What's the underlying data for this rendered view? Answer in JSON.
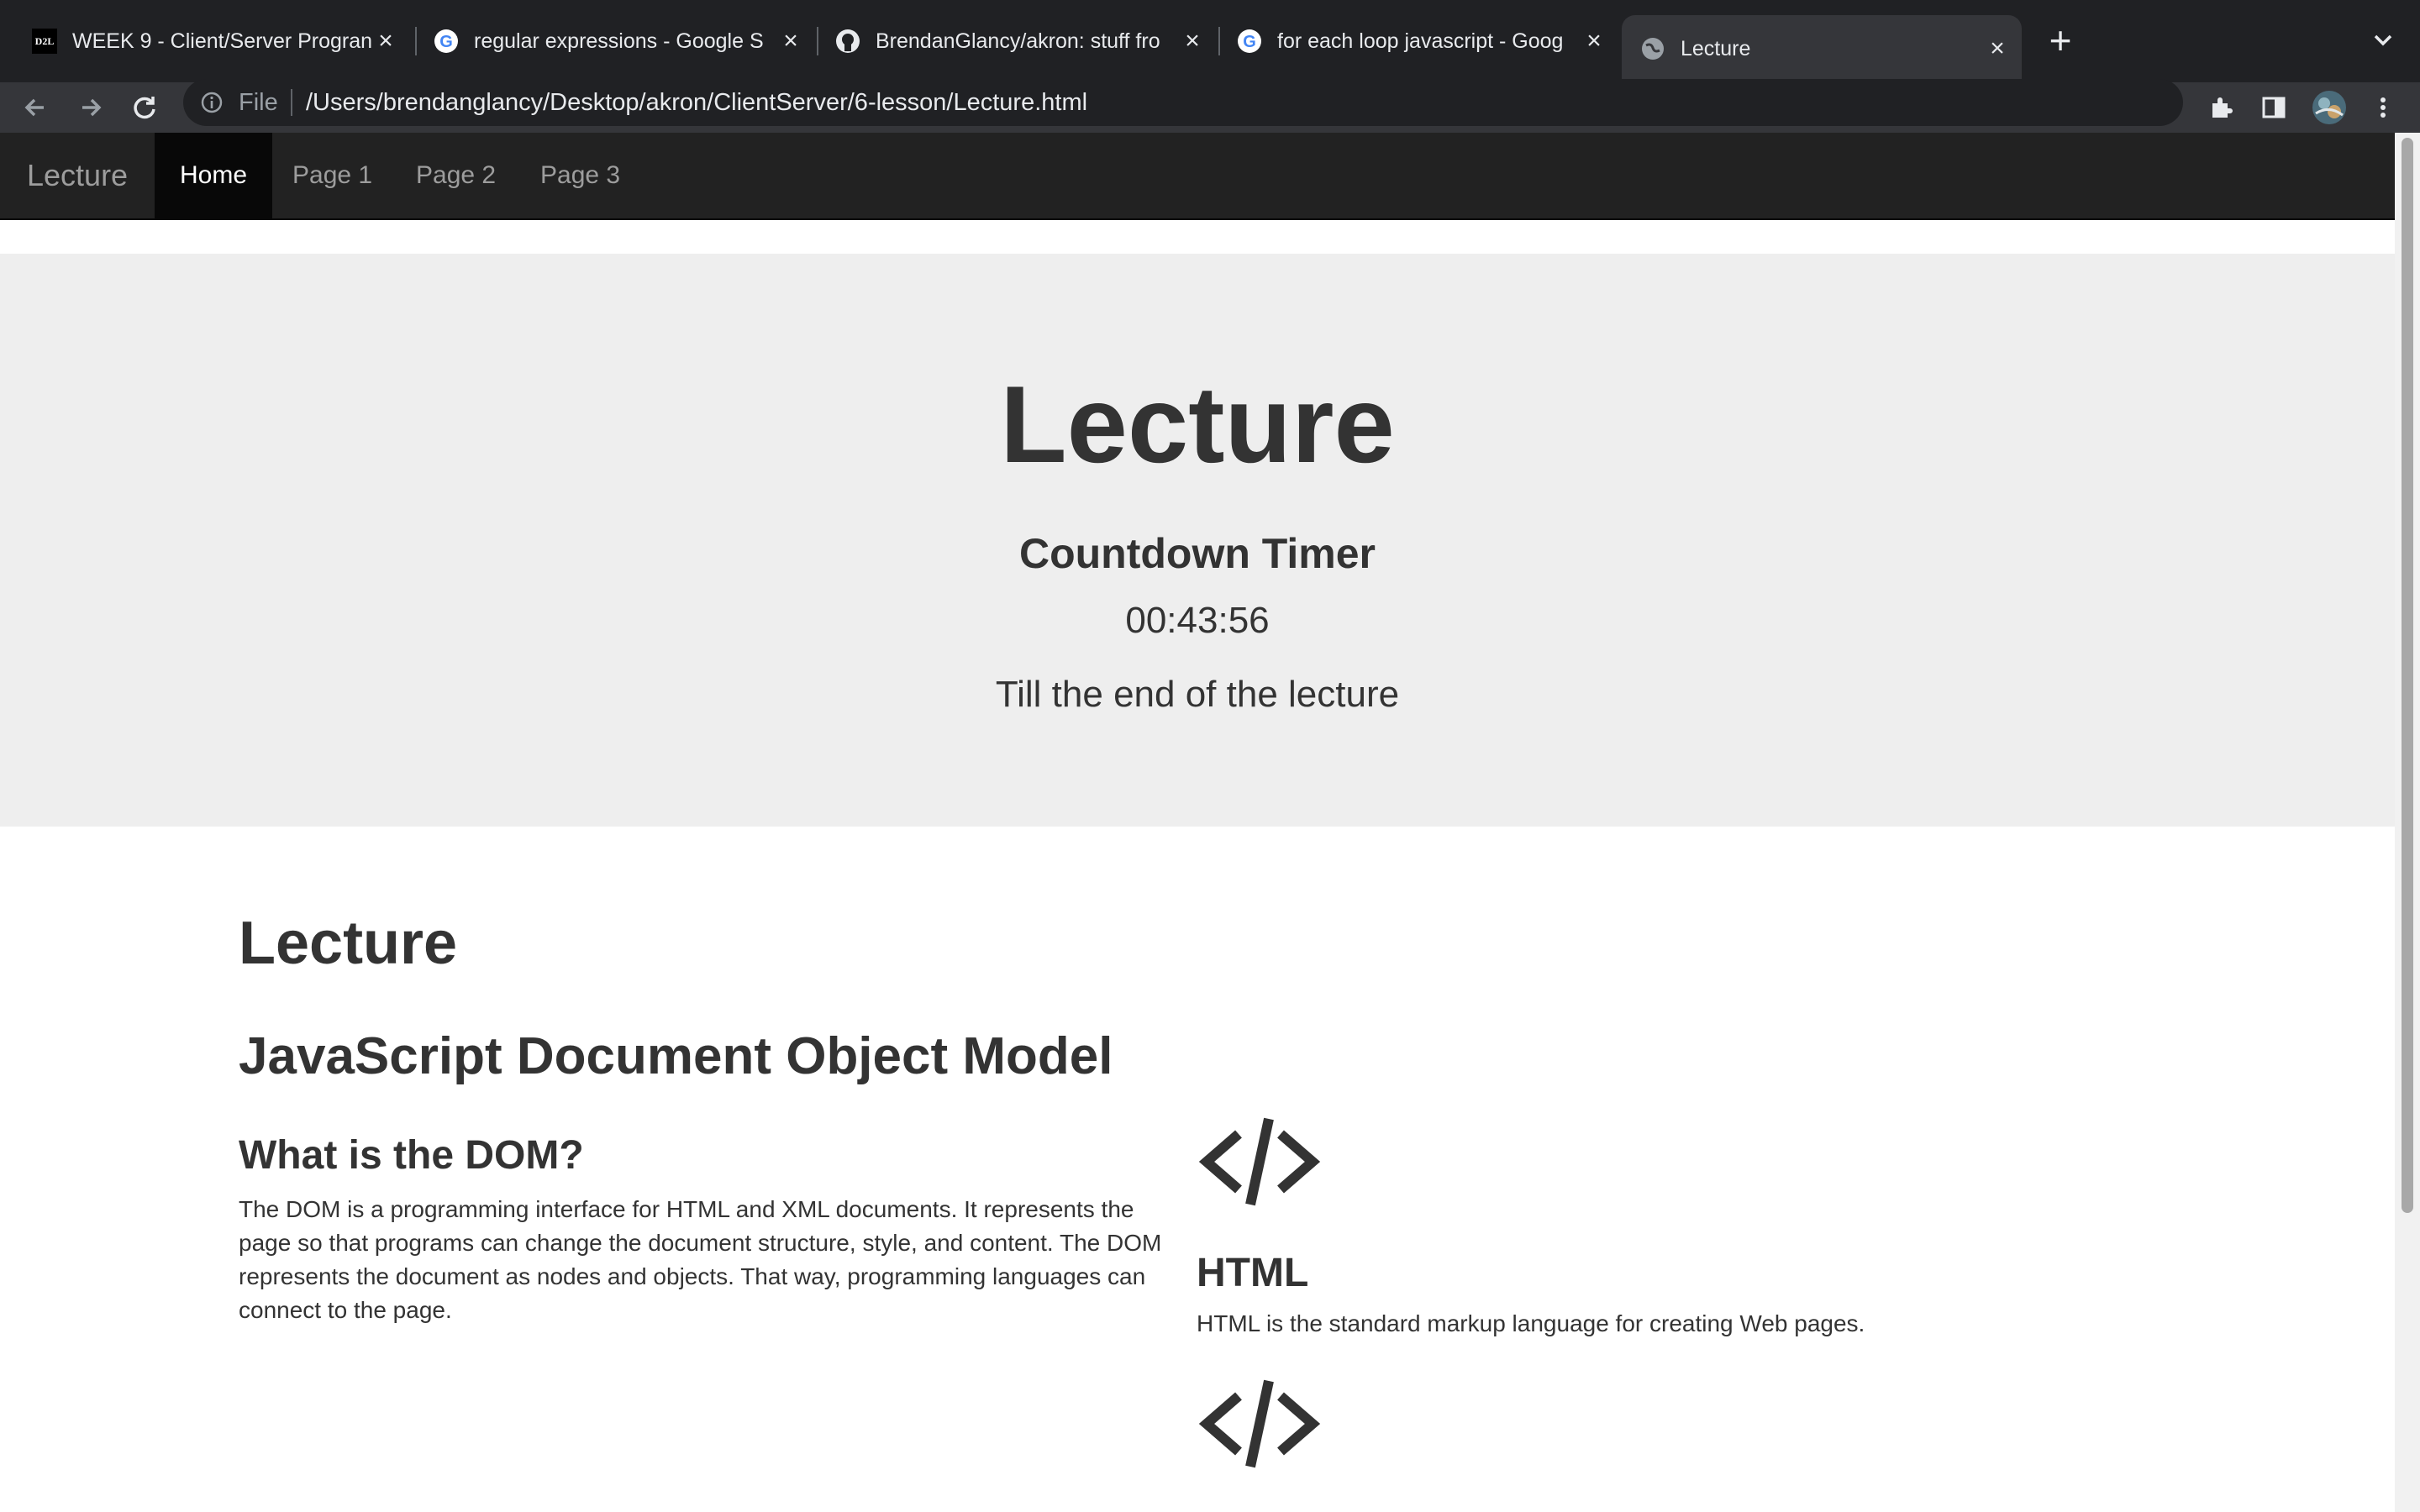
{
  "browser": {
    "tabs": [
      {
        "title": "WEEK 9 - Client/Server Progran",
        "favicon": "d2l-icon"
      },
      {
        "title": "regular expressions - Google S",
        "favicon": "google-icon"
      },
      {
        "title": "BrendanGlancy/akron: stuff fro",
        "favicon": "github-icon"
      },
      {
        "title": "for each loop javascript - Goog",
        "favicon": "google-icon"
      },
      {
        "title": "Lecture",
        "favicon": "globe-icon",
        "active": true
      }
    ],
    "url_scheme": "File",
    "url": "/Users/brendanglancy/Desktop/akron/ClientServer/6-lesson/Lecture.html",
    "d2l_favicon_text": "D2L"
  },
  "navbar": {
    "brand": "Lecture",
    "items": [
      {
        "label": "Home",
        "active": true
      },
      {
        "label": "Page 1"
      },
      {
        "label": "Page 2"
      },
      {
        "label": "Page 3"
      }
    ]
  },
  "jumbotron": {
    "title": "Lecture",
    "subtitle": "Countdown Timer",
    "timer": "00:43:56",
    "note": "Till the end of the lecture"
  },
  "content": {
    "heading": "Lecture",
    "subheading": "JavaScript Document Object Model",
    "section_title": "What is the DOM?",
    "section_text": "The DOM is a programming interface for HTML and XML documents. It represents the page so that programs can change the document structure, style, and content. The DOM represents the document as nodes and objects. That way, programming languages can connect to the page.",
    "card": {
      "icon": "code-icon",
      "title": "HTML",
      "text": "HTML is the standard markup language for creating Web pages."
    }
  },
  "colors": {
    "navbar_bg": "#222222",
    "jumbotron_bg": "#eeeeee",
    "text": "#333333",
    "chrome_dark": "#202124"
  }
}
